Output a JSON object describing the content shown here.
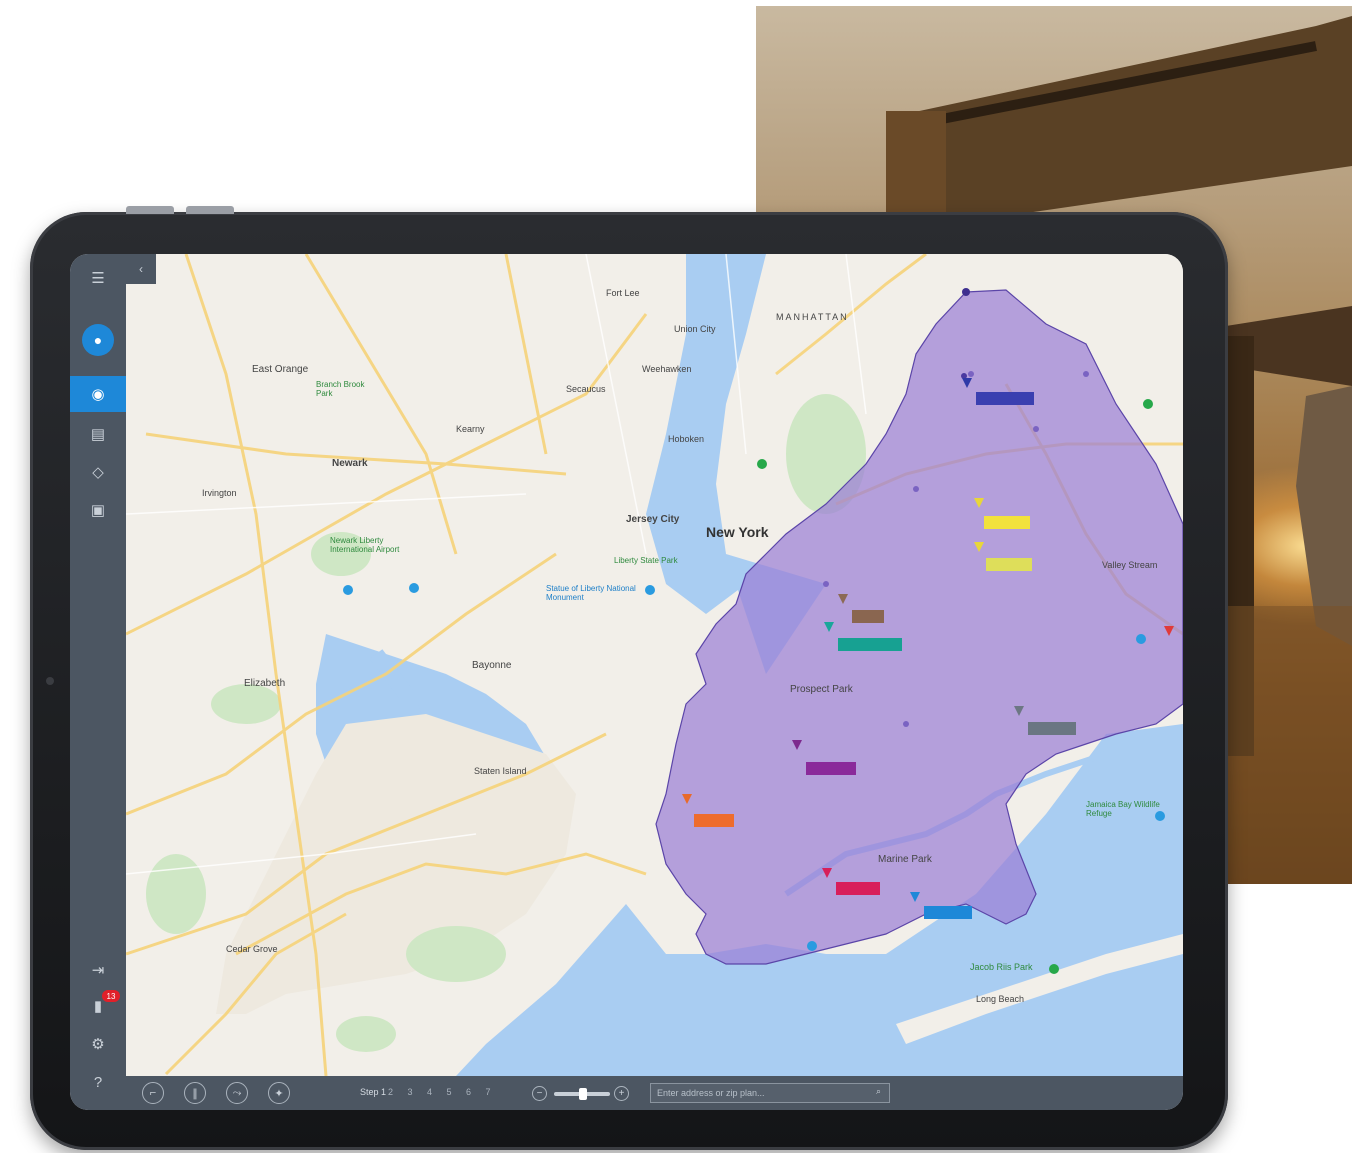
{
  "map": {
    "place_labels": [
      {
        "text": "East Orange"
      },
      {
        "text": "Newark"
      },
      {
        "text": "Jersey City"
      },
      {
        "text": "New York"
      },
      {
        "text": "Elizabeth"
      },
      {
        "text": "Bayonne"
      },
      {
        "text": "Prospect Park"
      },
      {
        "text": "Marine Park"
      },
      {
        "text": "MANHATTAN"
      },
      {
        "text": "Union City"
      },
      {
        "text": "Hoboken"
      },
      {
        "text": "Statue of Liberty National Monument"
      },
      {
        "text": "Liberty State Park"
      },
      {
        "text": "Newark Liberty International Airport"
      },
      {
        "text": "Kearny"
      },
      {
        "text": "Secaucus"
      },
      {
        "text": "Weehawken"
      },
      {
        "text": "Branch Brook Park"
      },
      {
        "text": "Irvington"
      },
      {
        "text": "Long Beach"
      },
      {
        "text": "Cedar Grove"
      },
      {
        "text": "Fort Lee"
      },
      {
        "text": "Staten Island"
      },
      {
        "text": "Jamaica Bay Wildlife Refuge"
      },
      {
        "text": "Jacob Riis Park"
      },
      {
        "text": "Valley Stream"
      }
    ]
  },
  "sidebar": {
    "notification_count": "13"
  },
  "bottombar": {
    "step_label": "Step 1",
    "steps": "2 3 4 5 6 7",
    "search_placeholder": "Enter address or zip plan..."
  },
  "colors": {
    "polygon_fill": "#9b7fd6",
    "sidebar_bg": "#4c5662",
    "accent": "#1e88d8",
    "water": "#a9cdf2",
    "land": "#f2efe9"
  }
}
